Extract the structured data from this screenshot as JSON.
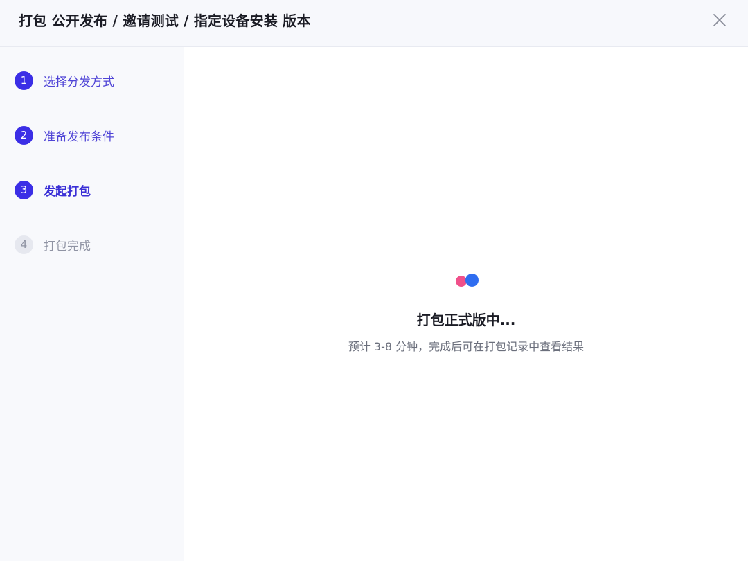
{
  "header": {
    "title": "打包 公开发布 / 邀请测试 / 指定设备安装 版本",
    "close_icon": "close-icon"
  },
  "steps": [
    {
      "number": "1",
      "label": "选择分发方式",
      "state": "done"
    },
    {
      "number": "2",
      "label": "准备发布条件",
      "state": "done"
    },
    {
      "number": "3",
      "label": "发起打包",
      "state": "active"
    },
    {
      "number": "4",
      "label": "打包完成",
      "state": "pending"
    }
  ],
  "main": {
    "loader_icon": "loading-dots-icon",
    "status_title": "打包正式版中...",
    "status_subtitle": "预计 3-8 分钟，完成后可在打包记录中查看结果"
  },
  "colors": {
    "accent": "#3b2ee6",
    "loader_pink": "#f0508a",
    "loader_blue": "#2f6df0",
    "pending": "#e6e8ef"
  }
}
